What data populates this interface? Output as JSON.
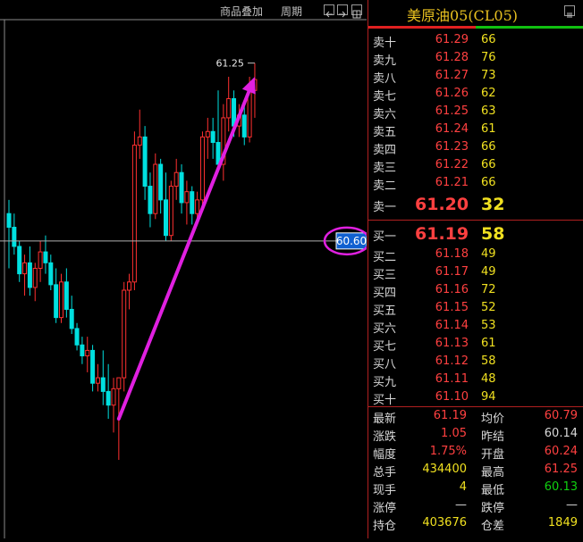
{
  "toolbar": {
    "overlay_label": "商品叠加",
    "period_label": "周期"
  },
  "chart": {
    "high_marker": "61.25",
    "price_tag": "60.60"
  },
  "candles": [
    {
      "o": 60.7,
      "h": 60.75,
      "l": 60.5,
      "c": 60.65
    },
    {
      "o": 60.65,
      "h": 60.7,
      "l": 60.55,
      "c": 60.58
    },
    {
      "o": 60.58,
      "h": 60.6,
      "l": 60.45,
      "c": 60.48
    },
    {
      "o": 60.48,
      "h": 60.55,
      "l": 60.4,
      "c": 60.52
    },
    {
      "o": 60.52,
      "h": 60.58,
      "l": 60.4,
      "c": 60.43
    },
    {
      "o": 60.43,
      "h": 60.52,
      "l": 60.38,
      "c": 60.5
    },
    {
      "o": 60.5,
      "h": 60.6,
      "l": 60.45,
      "c": 60.56
    },
    {
      "o": 60.56,
      "h": 60.62,
      "l": 60.48,
      "c": 60.52
    },
    {
      "o": 60.52,
      "h": 60.55,
      "l": 60.42,
      "c": 60.44
    },
    {
      "o": 60.44,
      "h": 60.5,
      "l": 60.3,
      "c": 60.32
    },
    {
      "o": 60.32,
      "h": 60.48,
      "l": 60.3,
      "c": 60.45
    },
    {
      "o": 60.45,
      "h": 60.5,
      "l": 60.32,
      "c": 60.35
    },
    {
      "o": 60.35,
      "h": 60.4,
      "l": 60.26,
      "c": 60.28
    },
    {
      "o": 60.28,
      "h": 60.3,
      "l": 60.2,
      "c": 60.22
    },
    {
      "o": 60.22,
      "h": 60.25,
      "l": 60.15,
      "c": 60.18
    },
    {
      "o": 60.18,
      "h": 60.25,
      "l": 60.12,
      "c": 60.2
    },
    {
      "o": 60.2,
      "h": 60.22,
      "l": 60.05,
      "c": 60.08
    },
    {
      "o": 60.08,
      "h": 60.15,
      "l": 60.05,
      "c": 60.1
    },
    {
      "o": 60.1,
      "h": 60.2,
      "l": 60.0,
      "c": 60.05
    },
    {
      "o": 60.05,
      "h": 60.15,
      "l": 59.95,
      "c": 60.0
    },
    {
      "o": 60.0,
      "h": 60.1,
      "l": 59.9,
      "c": 60.06
    },
    {
      "o": 60.06,
      "h": 60.1,
      "l": 59.8,
      "c": 60.1
    },
    {
      "o": 60.1,
      "h": 60.45,
      "l": 60.05,
      "c": 60.42
    },
    {
      "o": 60.42,
      "h": 60.48,
      "l": 60.35,
      "c": 60.45
    },
    {
      "o": 60.45,
      "h": 61.0,
      "l": 60.42,
      "c": 60.95
    },
    {
      "o": 60.95,
      "h": 61.08,
      "l": 60.9,
      "c": 60.98
    },
    {
      "o": 60.98,
      "h": 61.02,
      "l": 60.75,
      "c": 60.8
    },
    {
      "o": 60.8,
      "h": 60.85,
      "l": 60.65,
      "c": 60.7
    },
    {
      "o": 60.7,
      "h": 60.92,
      "l": 60.68,
      "c": 60.88
    },
    {
      "o": 60.88,
      "h": 60.9,
      "l": 60.7,
      "c": 60.75
    },
    {
      "o": 60.75,
      "h": 60.85,
      "l": 60.6,
      "c": 60.62
    },
    {
      "o": 60.62,
      "h": 60.82,
      "l": 60.6,
      "c": 60.8
    },
    {
      "o": 60.8,
      "h": 60.9,
      "l": 60.75,
      "c": 60.85
    },
    {
      "o": 60.85,
      "h": 60.88,
      "l": 60.7,
      "c": 60.74
    },
    {
      "o": 60.74,
      "h": 60.82,
      "l": 60.66,
      "c": 60.78
    },
    {
      "o": 60.78,
      "h": 60.8,
      "l": 60.66,
      "c": 60.7
    },
    {
      "o": 60.7,
      "h": 60.78,
      "l": 60.66,
      "c": 60.75
    },
    {
      "o": 60.75,
      "h": 61.0,
      "l": 60.72,
      "c": 60.98
    },
    {
      "o": 60.98,
      "h": 61.05,
      "l": 60.9,
      "c": 61.0
    },
    {
      "o": 61.0,
      "h": 61.05,
      "l": 60.9,
      "c": 60.96
    },
    {
      "o": 60.96,
      "h": 61.15,
      "l": 60.85,
      "c": 60.88
    },
    {
      "o": 60.88,
      "h": 61.1,
      "l": 60.82,
      "c": 61.05
    },
    {
      "o": 61.05,
      "h": 61.2,
      "l": 61.0,
      "c": 61.12
    },
    {
      "o": 61.12,
      "h": 61.15,
      "l": 60.98,
      "c": 61.02
    },
    {
      "o": 61.02,
      "h": 61.1,
      "l": 60.98,
      "c": 61.06
    },
    {
      "o": 61.06,
      "h": 61.1,
      "l": 60.95,
      "c": 60.98
    },
    {
      "o": 60.98,
      "h": 61.2,
      "l": 60.96,
      "c": 61.15
    },
    {
      "o": 61.15,
      "h": 61.25,
      "l": 61.05,
      "c": 61.19
    }
  ],
  "quote": {
    "title": "美原油05(CL05)",
    "asks": [
      {
        "label": "卖十",
        "price": "61.29",
        "vol": "66"
      },
      {
        "label": "卖九",
        "price": "61.28",
        "vol": "76"
      },
      {
        "label": "卖八",
        "price": "61.27",
        "vol": "73"
      },
      {
        "label": "卖七",
        "price": "61.26",
        "vol": "62"
      },
      {
        "label": "卖六",
        "price": "61.25",
        "vol": "63"
      },
      {
        "label": "卖五",
        "price": "61.24",
        "vol": "61"
      },
      {
        "label": "卖四",
        "price": "61.23",
        "vol": "66"
      },
      {
        "label": "卖三",
        "price": "61.22",
        "vol": "66"
      },
      {
        "label": "卖二",
        "price": "61.21",
        "vol": "66"
      },
      {
        "label": "卖一",
        "price": "61.20",
        "vol": "32"
      }
    ],
    "bids": [
      {
        "label": "买一",
        "price": "61.19",
        "vol": "58"
      },
      {
        "label": "买二",
        "price": "61.18",
        "vol": "49"
      },
      {
        "label": "买三",
        "price": "61.17",
        "vol": "49"
      },
      {
        "label": "买四",
        "price": "61.16",
        "vol": "72"
      },
      {
        "label": "买五",
        "price": "61.15",
        "vol": "52"
      },
      {
        "label": "买六",
        "price": "61.14",
        "vol": "53"
      },
      {
        "label": "买七",
        "price": "61.13",
        "vol": "61"
      },
      {
        "label": "买八",
        "price": "61.12",
        "vol": "58"
      },
      {
        "label": "买九",
        "price": "61.11",
        "vol": "48"
      },
      {
        "label": "买十",
        "price": "61.10",
        "vol": "94"
      }
    ],
    "stats": [
      {
        "l1": "最新",
        "v1": "61.19",
        "c1": "#ff4040",
        "l2": "均价",
        "v2": "60.79",
        "c2": "#ff4040"
      },
      {
        "l1": "涨跌",
        "v1": "1.05",
        "c1": "#ff4040",
        "l2": "昨结",
        "v2": "60.14",
        "c2": "#d8d8d8"
      },
      {
        "l1": "幅度",
        "v1": "1.75%",
        "c1": "#ff4040",
        "l2": "开盘",
        "v2": "60.24",
        "c2": "#ff4040"
      },
      {
        "l1": "总手",
        "v1": "434400",
        "c1": "#f0e020",
        "l2": "最高",
        "v2": "61.25",
        "c2": "#ff4040"
      },
      {
        "l1": "现手",
        "v1": "4",
        "c1": "#f0e020",
        "l2": "最低",
        "v2": "60.13",
        "c2": "#10d010"
      },
      {
        "l1": "涨停",
        "v1": "—",
        "c1": "#d8d8d8",
        "l2": "跌停",
        "v2": "—",
        "c2": "#d8d8d8"
      },
      {
        "l1": "持仓",
        "v1": "403676",
        "c1": "#f0e020",
        "l2": "仓差",
        "v2": "1849",
        "c2": "#f0e020"
      }
    ]
  },
  "colors": {
    "up": "#ff3030",
    "down": "#00e0e0",
    "arrow": "#e020e0",
    "crosshair": "#b0b0b0"
  }
}
